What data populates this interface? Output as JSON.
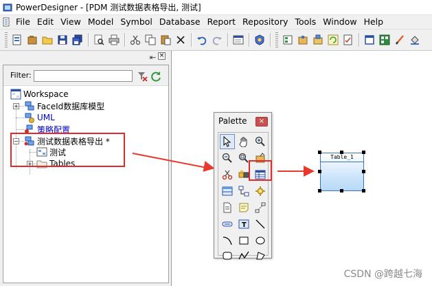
{
  "window": {
    "title": "PowerDesigner - [PDM 测试数据表格导出, 测试]"
  },
  "menu": [
    "File",
    "Edit",
    "View",
    "Model",
    "Symbol",
    "Database",
    "Report",
    "Repository",
    "Tools",
    "Window",
    "Help"
  ],
  "toolbar_icons": [
    "new-model-icon",
    "open-icon",
    "folder-icon",
    "save-icon",
    "save-all-icon",
    "print-preview-icon",
    "print-icon",
    "cut-icon",
    "copy-icon",
    "paste-icon",
    "delete-icon",
    "undo-icon",
    "redo-icon",
    "properties-icon",
    "check-model-icon",
    "grip",
    "browser-icon",
    "package-icon",
    "generate-icon",
    "refresh-model-icon",
    "report-icon",
    "window-icon",
    "palette-icon",
    "pen-icon",
    "fill-icon"
  ],
  "browser": {
    "pin_glyph": "⇤",
    "close_glyph": "×",
    "filter": {
      "label": "Filter:",
      "value": "",
      "placeholder": ""
    },
    "tree": {
      "workspace": "Workspace",
      "faceid_model": "FaceId数据库模型",
      "uml": "UML",
      "strategy": "策略配置",
      "pdm_model": "测试数据表格导出 *",
      "test_diagram": "测试",
      "tables": "Tables"
    }
  },
  "palette": {
    "title": "Palette",
    "close_glyph": "×",
    "tools": [
      "pointer-icon",
      "grabber-icon",
      "zoom-in-icon",
      "zoom-out-icon",
      "zoom-fit-icon",
      "open-package-icon",
      "cut-tool-icon",
      "package-tool-icon",
      "table-tool-icon",
      "view-tool-icon",
      "reference-tool-icon",
      "procedure-tool-icon",
      "file-tool-icon",
      "note-tool-icon",
      "link-tool-icon",
      "rectangle-tool-icon",
      "text-tool-icon",
      "line-tool-icon",
      "arc-tool-icon",
      "rect-shape-icon",
      "ellipse-tool-icon",
      "rounded-rect-icon",
      "polyline-icon",
      "polygon-icon"
    ]
  },
  "diagram": {
    "table_name": "Table_1"
  },
  "watermark": "CSDN @跨越七海",
  "colors": {
    "highlight": "#e02a2a",
    "arrow": "#e8392e",
    "table_border": "#3a73b5",
    "table_fill": "#cfe6fb"
  }
}
